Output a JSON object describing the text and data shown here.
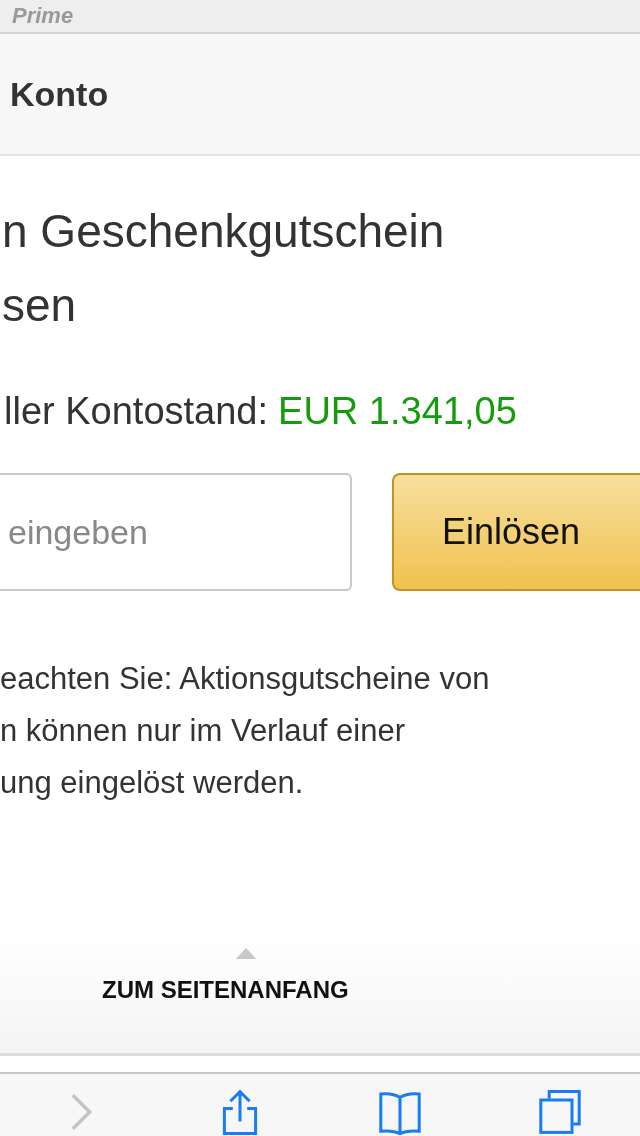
{
  "header": {
    "brand": "Prime"
  },
  "section_title": "Konto",
  "heading_lines": [
    "n Geschenkgutschein",
    "sen"
  ],
  "balance": {
    "label": "ller Kontostand:",
    "amount": "EUR 1.341,05"
  },
  "code_field": {
    "placeholder": "eingeben"
  },
  "redeem_button": "Einlösen",
  "note_lines": [
    "eachten Sie:  Aktionsgutscheine von",
    "n können nur im Verlauf einer",
    "ung eingelöst werden."
  ],
  "back_to_top": "ZUM SEITENANFANG",
  "toolbar": [
    {
      "kind": "forward",
      "disabled": true
    },
    {
      "kind": "share",
      "disabled": false
    },
    {
      "kind": "bookmarks",
      "disabled": false
    },
    {
      "kind": "tabs",
      "disabled": false
    }
  ]
}
